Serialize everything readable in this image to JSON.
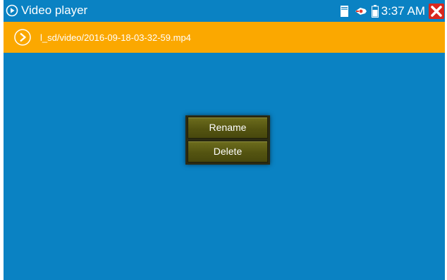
{
  "statusbar": {
    "app_icon": "play-circle-icon",
    "title": "Video player",
    "icons": [
      "sd-card-icon",
      "usb-icon",
      "battery-icon"
    ],
    "time": "3:37 AM",
    "close_icon": "close-icon"
  },
  "pathbar": {
    "icon": "play-circle-icon",
    "path": "l_sd/video/2016-09-18-03-32-59.mp4"
  },
  "dialog": {
    "rename_label": "Rename",
    "delete_label": "Delete"
  },
  "colors": {
    "background": "#0a82c3",
    "pathbar": "#fba800",
    "close": "#d9281e",
    "button": "#5c5c15"
  }
}
